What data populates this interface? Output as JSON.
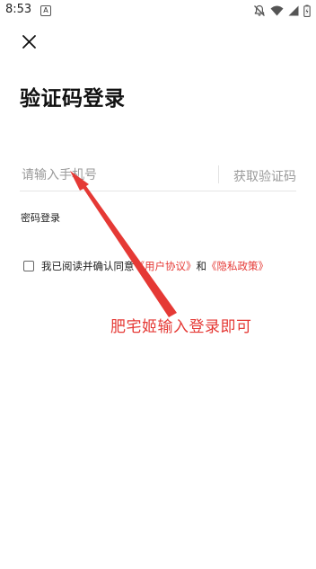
{
  "status_bar": {
    "time": "8:53",
    "badge": "A"
  },
  "page": {
    "title": "验证码登录",
    "close_icon": "close-icon"
  },
  "phone_field": {
    "placeholder": "请输入手机号",
    "value": ""
  },
  "get_code_label": "获取验证码",
  "password_login_label": "密码登录",
  "agreement": {
    "checked": false,
    "prefix": "我已阅读并确认同意",
    "user_agreement": "《用户协议》",
    "conjunction": "和",
    "privacy_policy": "《隐私政策》"
  },
  "annotation": {
    "text": "肥宅姬输入登录即可",
    "color": "#e53935"
  },
  "colors": {
    "link_red": "#e53935",
    "placeholder_gray": "#9a9a9a"
  }
}
